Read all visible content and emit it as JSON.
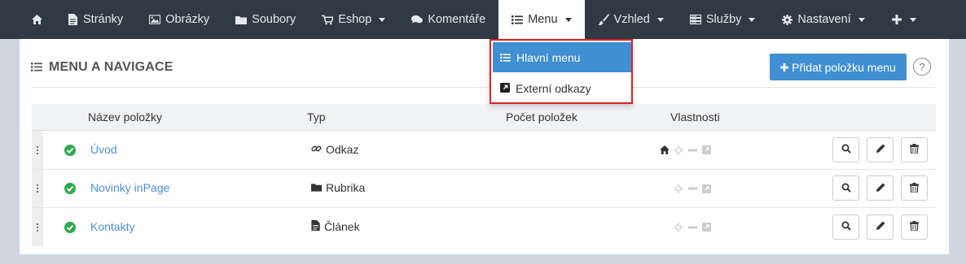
{
  "nav": {
    "items": [
      {
        "label": "",
        "icon": "home-icon"
      },
      {
        "label": "Stránky",
        "icon": "file-icon"
      },
      {
        "label": "Obrázky",
        "icon": "image-icon"
      },
      {
        "label": "Soubory",
        "icon": "folder-icon"
      },
      {
        "label": "Eshop",
        "icon": "cart-icon"
      },
      {
        "label": "Komentáře",
        "icon": "comments-icon"
      },
      {
        "label": "Menu",
        "icon": "list-icon"
      },
      {
        "label": "Vzhled",
        "icon": "brush-icon"
      },
      {
        "label": "Služby",
        "icon": "server-icon"
      },
      {
        "label": "Nastavení",
        "icon": "gear-icon"
      },
      {
        "label": "",
        "icon": "plus-icon"
      }
    ]
  },
  "dropdown": {
    "items": [
      {
        "label": "Hlavní menu",
        "icon": "list-icon"
      },
      {
        "label": "Externí odkazy",
        "icon": "external-link-icon"
      }
    ]
  },
  "panel": {
    "title": "MENU A NAVIGACE",
    "add_button": "Přidat položku menu",
    "help": "?"
  },
  "table": {
    "columns": [
      "Název položky",
      "Typ",
      "Počet položek",
      "Vlastnosti"
    ],
    "rows": [
      {
        "name": "Úvod",
        "type": "Odkaz",
        "type_icon": "link-icon",
        "is_home": true
      },
      {
        "name": "Novinky inPage",
        "type": "Rubrika",
        "type_icon": "folder-icon",
        "is_home": false
      },
      {
        "name": "Kontakty",
        "type": "Článek",
        "type_icon": "document-icon",
        "is_home": false
      }
    ]
  },
  "colors": {
    "nav_bg": "#2f3a45",
    "accent": "#3f8fd2",
    "status_ok": "#2fa84f",
    "link": "#4a90d9",
    "highlight_border": "#e0202a"
  }
}
